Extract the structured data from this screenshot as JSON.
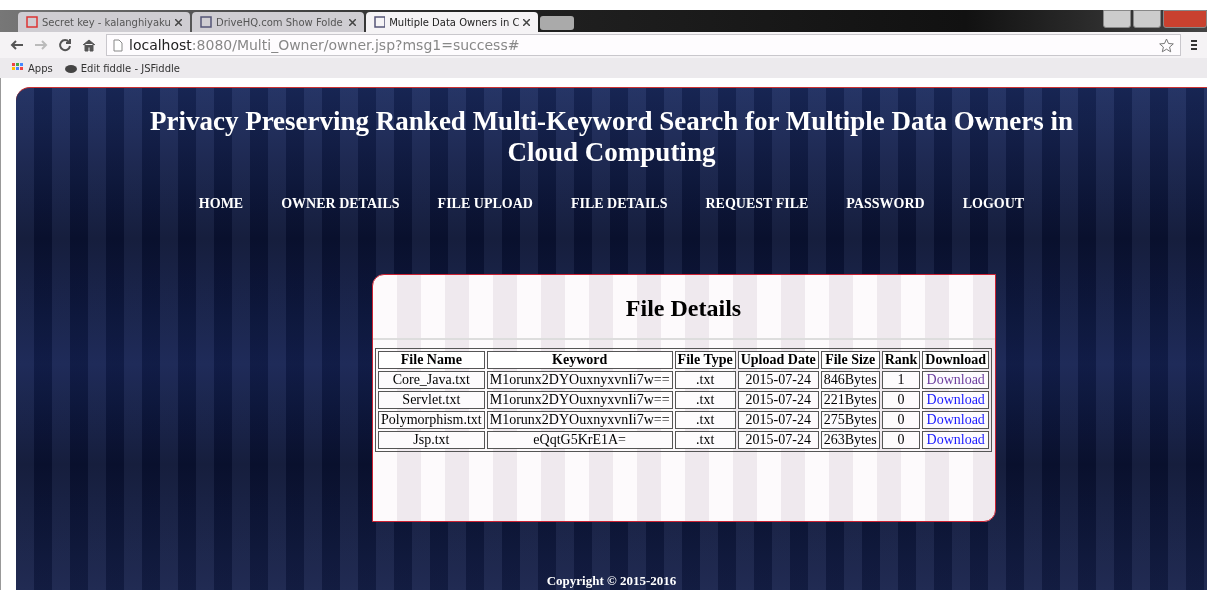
{
  "browser": {
    "tabs": [
      {
        "label": "Secret key - kalanghiyaku",
        "selected": false
      },
      {
        "label": "DriveHQ.com Show Folde",
        "selected": false
      },
      {
        "label": "Multiple Data Owners in C",
        "selected": true
      }
    ],
    "url_host": "localhost",
    "url_rest": ":8080/Multi_Owner/owner.jsp?msg1=success#",
    "bookmarks": [
      "Apps",
      "Edit fiddle - JSFiddle"
    ]
  },
  "header": {
    "title": "Privacy Preserving Ranked Multi-Keyword Search for Multiple Data Owners in Cloud Computing"
  },
  "nav": [
    "HOME",
    "OWNER DETAILS",
    "FILE UPLOAD",
    "FILE DETAILS",
    "REQUEST FILE",
    "PASSWORD",
    "LOGOUT"
  ],
  "card": {
    "title": "File Details",
    "table": {
      "columns": [
        "File Name",
        "Keyword",
        "File Type",
        "Upload Date",
        "File Size",
        "Rank",
        "Download"
      ],
      "rows": [
        {
          "cells": [
            "Core_Java.txt",
            "M1orunx2DYOuxnyxvnIi7w==",
            ".txt",
            "2015-07-24",
            "846Bytes",
            "1"
          ],
          "link": "Download",
          "visited": true
        },
        {
          "cells": [
            "Servlet.txt",
            "M1orunx2DYOuxnyxvnIi7w==",
            ".txt",
            "2015-07-24",
            "221Bytes",
            "0"
          ],
          "link": "Download",
          "visited": false
        },
        {
          "cells": [
            "Polymorphism.txt",
            "M1orunx2DYOuxnyxvnIi7w==",
            ".txt",
            "2015-07-24",
            "275Bytes",
            "0"
          ],
          "link": "Download",
          "visited": false
        },
        {
          "cells": [
            "Jsp.txt",
            "eQqtG5KrE1A=",
            ".txt",
            "2015-07-24",
            "263Bytes",
            "0"
          ],
          "link": "Download",
          "visited": false
        }
      ]
    }
  },
  "footer": "Copyright © 2015-2016"
}
